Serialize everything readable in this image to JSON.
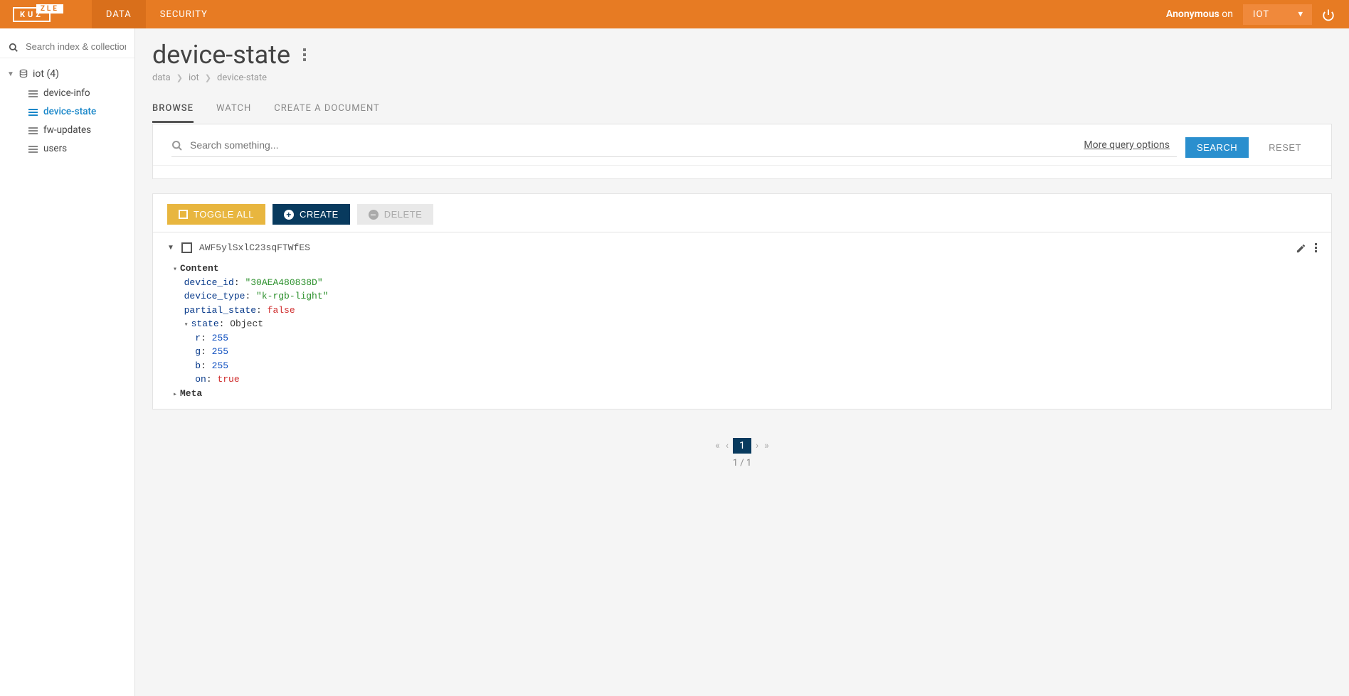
{
  "topbar": {
    "logo_main": "KUZ",
    "logo_sub": "ZLE",
    "nav": {
      "data": "DATA",
      "security": "SECURITY"
    },
    "user_prefix": "Anonymous",
    "user_suffix": "on",
    "env": "IOT"
  },
  "sidebar": {
    "search_placeholder": "Search index & collection",
    "index_label": "iot (4)",
    "collections": {
      "0": "device-info",
      "1": "device-state",
      "2": "fw-updates",
      "3": "users"
    }
  },
  "header": {
    "title": "device-state",
    "breadcrumb": {
      "0": "data",
      "1": "iot",
      "2": "device-state"
    }
  },
  "tabs": {
    "browse": "BROWSE",
    "watch": "WATCH",
    "create": "CREATE A DOCUMENT"
  },
  "search": {
    "placeholder": "Search something...",
    "more": "More query options",
    "go": "SEARCH",
    "reset": "RESET"
  },
  "toolbar": {
    "toggle": "TOGGLE ALL",
    "create": "CREATE",
    "delete": "DELETE"
  },
  "doc": {
    "id": "AWF5ylSxlC23sqFTWfES",
    "content_label": "Content",
    "device_id_k": "device_id",
    "device_id_v": "\"30AEA480838D\"",
    "device_type_k": "device_type",
    "device_type_v": "\"k-rgb-light\"",
    "partial_k": "partial_state",
    "partial_v": "false",
    "state_k": "state",
    "state_v": "Object",
    "r_k": "r",
    "r_v": "255",
    "g_k": "g",
    "g_v": "255",
    "b_k": "b",
    "b_v": "255",
    "on_k": "on",
    "on_v": "true",
    "meta_label": "Meta"
  },
  "pager": {
    "current": "1",
    "info": "1 / 1"
  }
}
